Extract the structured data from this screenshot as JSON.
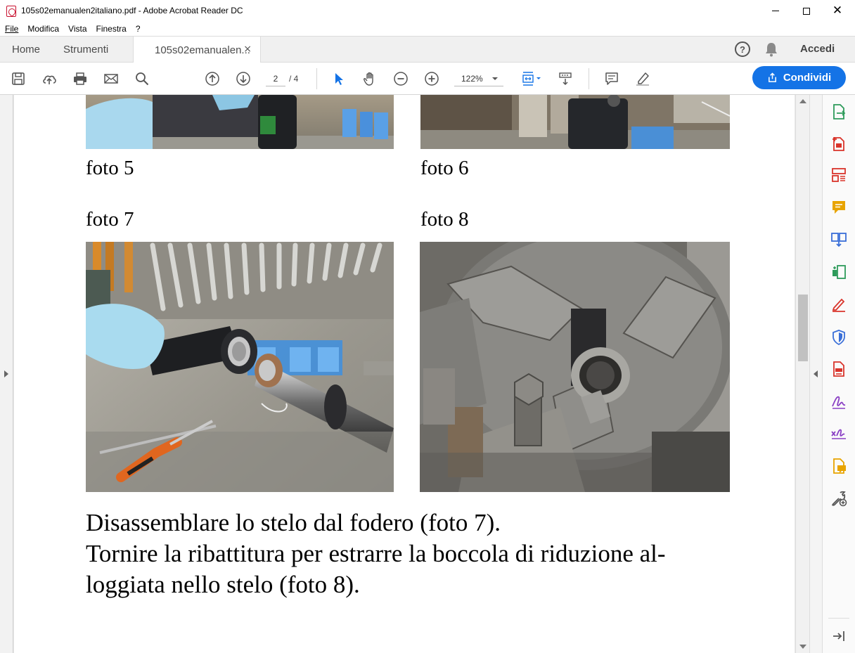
{
  "window": {
    "title": "105s02emanualen2italiano.pdf - Adobe Acrobat Reader DC",
    "min_label": "—",
    "close_label": "✕"
  },
  "menu": [
    "File",
    "Modifica",
    "Vista",
    "Finestra",
    "?"
  ],
  "tabs": {
    "home": "Home",
    "tools": "Strumenti",
    "document": "105s02emanualen...",
    "close": "×"
  },
  "header_right": {
    "help": "?",
    "signin": "Accedi"
  },
  "toolbar": {
    "current_page": "2",
    "total_pages": "/ 4",
    "zoom": "122%",
    "share_label": "Condividi"
  },
  "document": {
    "captions": {
      "foto5": "foto 5",
      "foto6": "foto 6",
      "foto7": "foto 7",
      "foto8": "foto 8"
    },
    "paragraphs": [
      " Disassemblare lo stelo dal fodero (foto 7).",
      " Tornire la ribattitura per estrarre la boccola di riduzione al-",
      "loggiata nello stelo (foto 8)."
    ]
  },
  "right_tools": [
    {
      "icon": "export-pdf-icon",
      "color": "#2d9b5a"
    },
    {
      "icon": "create-pdf-icon",
      "color": "#d9342b"
    },
    {
      "icon": "organize-pages-icon",
      "color": "#d9342b"
    },
    {
      "icon": "comment-icon",
      "color": "#e8a400"
    },
    {
      "icon": "combine-files-icon",
      "color": "#3a6fd8"
    },
    {
      "icon": "compress-pdf-icon",
      "color": "#2d9b5a"
    },
    {
      "icon": "fill-sign-icon",
      "color": "#d9342b"
    },
    {
      "icon": "protect-icon",
      "color": "#3a6fd8"
    },
    {
      "icon": "pdf-edit-icon",
      "color": "#d9342b"
    },
    {
      "icon": "send-for-signature-icon",
      "color": "#8a3fc4"
    },
    {
      "icon": "certificates-icon",
      "color": "#8a3fc4"
    },
    {
      "icon": "send-for-comments-icon",
      "color": "#e8a400"
    },
    {
      "icon": "more-tools-icon",
      "color": "#555555"
    }
  ],
  "colors": {
    "accent": "#1473e6",
    "toolbar_icon": "#555555",
    "selected_tool": "#1473e6"
  }
}
